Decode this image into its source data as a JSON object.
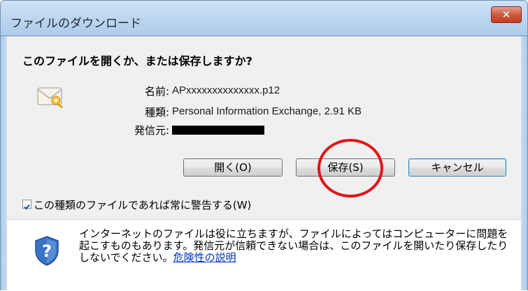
{
  "window": {
    "title": "ファイルのダウンロード",
    "close_glyph": "✕"
  },
  "dialog": {
    "question": "このファイルを開くか、または保存しますか?",
    "file": {
      "name_label": "名前:",
      "name_value": "APxxxxxxxxxxxxxx.p12",
      "type_label": "種類:",
      "type_value": "Personal Information Exchange, 2.91 KB",
      "from_label": "発信元:"
    },
    "buttons": {
      "open": "開く(O)",
      "save": "保存(S)",
      "cancel": "キャンセル"
    },
    "checkbox": {
      "label": "この種類のファイルであれば常に警告する(W)",
      "checked": true
    },
    "warning": {
      "text": "インターネットのファイルは役に立ちますが、ファイルによってはコンピューターに問題を起こすものもあります。発信元が信頼できない場合は、このファイルを開いたり保存したりしないでください。",
      "link": "危険性の説明"
    }
  },
  "colors": {
    "highlight_circle": "#e0141a",
    "link": "#0033cc",
    "title_bar": "#bcd5ef"
  }
}
